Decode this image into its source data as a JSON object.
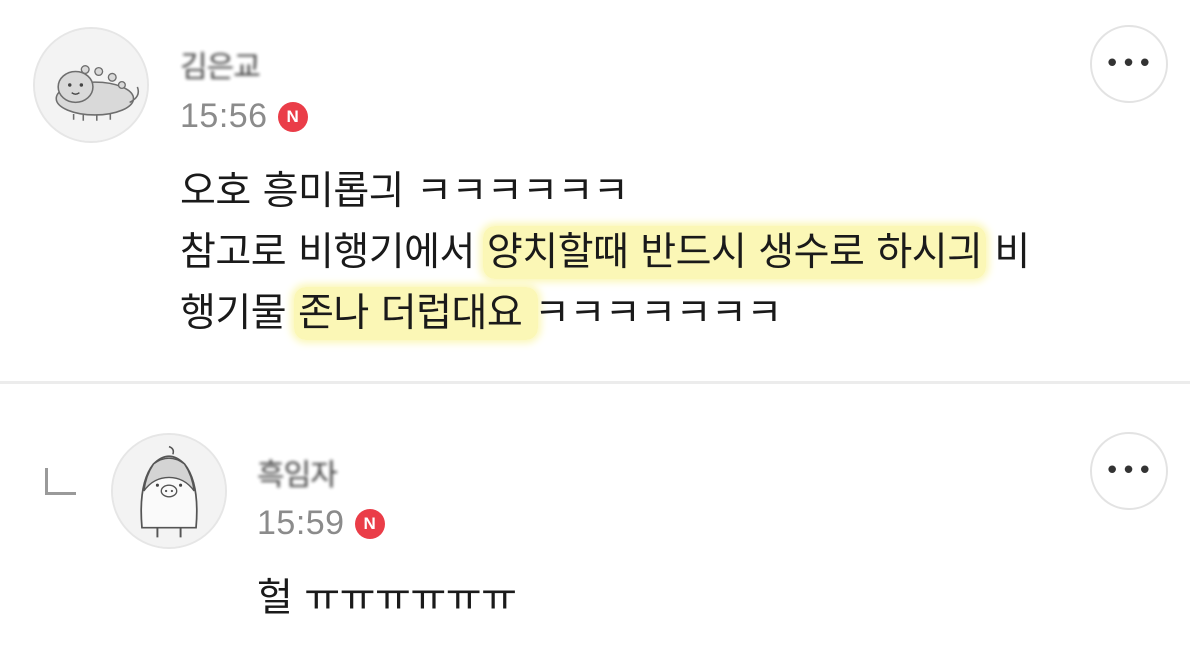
{
  "comments": [
    {
      "author": "김은교",
      "time": "15:56",
      "badge": "N",
      "lines": [
        {
          "segments": [
            {
              "text": "오호 흥미롭긔 ㅋㅋㅋㅋㅋㅋ",
              "highlight": false
            }
          ]
        },
        {
          "segments": [
            {
              "text": "참고로 비행기에서 ",
              "highlight": false
            },
            {
              "text": "양치할때 반드시 생수로 하시긔",
              "highlight": true
            },
            {
              "text": " 비",
              "highlight": false
            }
          ]
        },
        {
          "segments": [
            {
              "text": "행기물 ",
              "highlight": false
            },
            {
              "text": "존나 더럽대요 ",
              "highlight": true
            },
            {
              "text": "ㅋㅋㅋㅋㅋㅋㅋ",
              "highlight": false
            }
          ]
        }
      ],
      "more_label": "•••",
      "avatar_icon": "dinosaur-avatar-icon"
    },
    {
      "author": "흑임자",
      "time": "15:59",
      "badge": "N",
      "text": "헐 ㅠㅠㅠㅠㅠㅠ",
      "more_label": "•••",
      "avatar_icon": "penguin-avatar-icon",
      "reply_icon": "reply-arrow-icon"
    }
  ],
  "colors": {
    "highlight": "#fbf7b6",
    "badge": "#ea3d48",
    "time": "#8b8b8b"
  }
}
